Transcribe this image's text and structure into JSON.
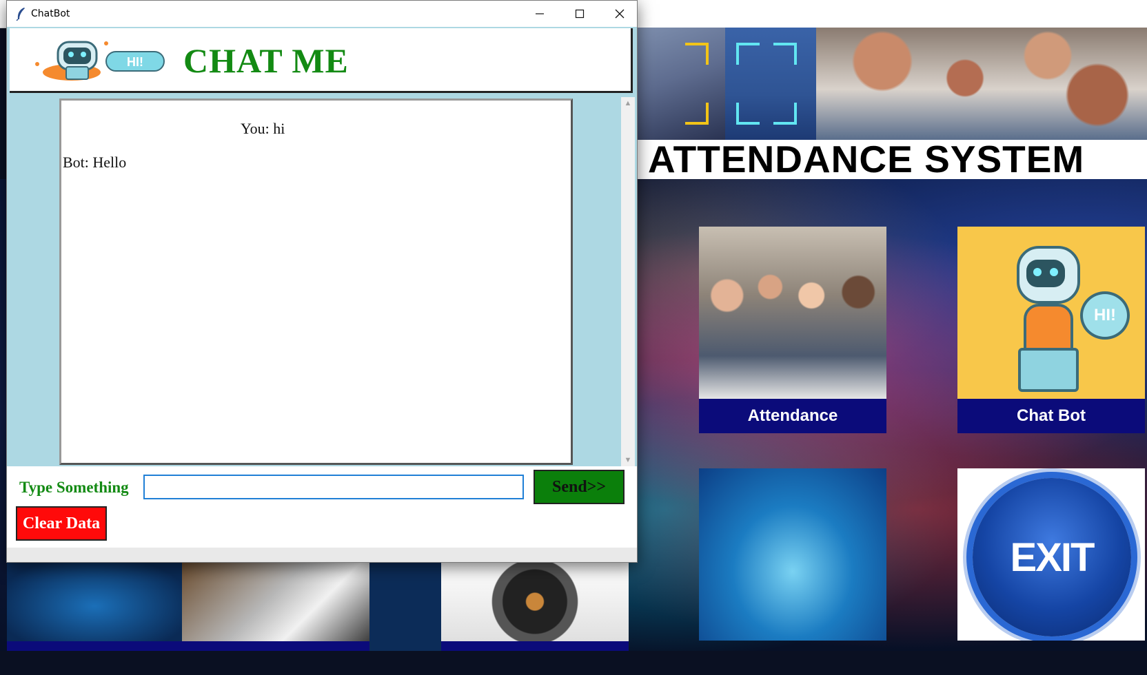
{
  "chat_window": {
    "title": "ChatBot",
    "header_title": "CHAT ME",
    "header_logo_text": "HI!",
    "messages": [
      {
        "text": "You: hi",
        "align": "center"
      },
      {
        "text": "Bot: Hello",
        "align": "left"
      }
    ],
    "input": {
      "label": "Type Something",
      "value": ""
    },
    "send_label": "Send>>",
    "clear_label": "Clear Data",
    "controls": {
      "minimize_icon": "minimize-icon",
      "maximize_icon": "maximize-icon",
      "close_icon": "close-icon"
    }
  },
  "main_window": {
    "title": "ATTENDANCE SYSTEM",
    "tiles": [
      {
        "label": "Attendance",
        "icon": "attendance-photo"
      },
      {
        "label": "Chat Bot",
        "icon": "robot-icon"
      }
    ],
    "exit_text": "EXIT",
    "chatbot_bubble_text": "HI!"
  },
  "colors": {
    "header_green": "#138a13",
    "send_green": "#0b7f0b",
    "clear_red": "#ff0a0a",
    "chat_frame_bg": "#add8e3",
    "tile_band": "#0b0b7a"
  }
}
